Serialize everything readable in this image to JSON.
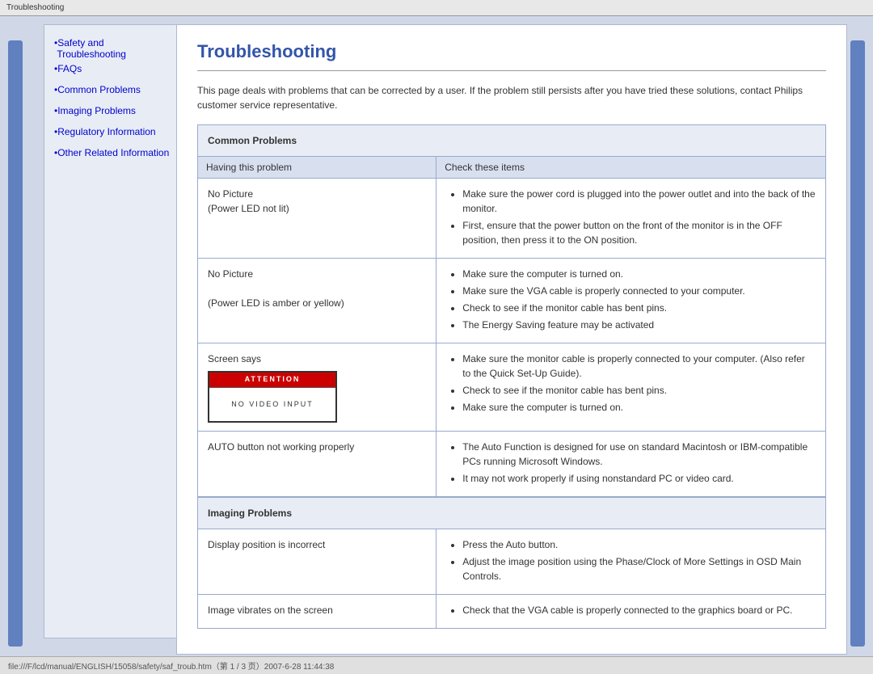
{
  "browser": {
    "title": "Troubleshooting",
    "status_bar": "file:///F/lcd/manual/ENGLISH/15058/safety/saf_troub.htm（第 1 / 3 页）2007-6-28 11:44:38"
  },
  "sidebar": {
    "links": [
      {
        "label": "Safety and Troubleshooting",
        "href": "#"
      },
      {
        "label": "FAQs",
        "href": "#"
      },
      {
        "label": "Common Problems",
        "href": "#"
      },
      {
        "label": "Imaging Problems",
        "href": "#"
      },
      {
        "label": "Regulatory Information",
        "href": "#"
      },
      {
        "label": "Other Related Information",
        "href": "#"
      }
    ]
  },
  "content": {
    "title": "Troubleshooting",
    "intro": "This page deals with problems that can be corrected by a user. If the problem still persists after you have tried these solutions, contact Philips customer service representative.",
    "common_problems_header": "Common Problems",
    "col_problem": "Having this problem",
    "col_solution": "Check these items",
    "problems": [
      {
        "problem": "No Picture\n(Power LED not lit)",
        "solutions": [
          "Make sure the power cord is plugged into the power outlet and into the back of the monitor.",
          "First, ensure that the power button on the front of the monitor is in the OFF position, then press it to the ON position."
        ]
      },
      {
        "problem": "No Picture\n\n(Power LED is amber or yellow)",
        "solutions": [
          "Make sure the computer is turned on.",
          "Make sure the VGA cable is properly connected to your computer.",
          "Check to see if the monitor cable has bent pins.",
          "The Energy Saving feature may be activated"
        ]
      },
      {
        "problem": "Screen says",
        "attention_label": "ATTENTION",
        "attention_body": "NO VIDEO INPUT",
        "solutions": [
          "Make sure the monitor cable is properly connected to your computer. (Also refer to the Quick Set-Up Guide).",
          "Check to see if the monitor cable has bent pins.",
          "Make sure the computer is turned on."
        ]
      },
      {
        "problem": "AUTO button not working properly",
        "solutions": [
          "The Auto Function is designed for use on standard Macintosh or IBM-compatible PCs running Microsoft Windows.",
          "It may not work properly if using nonstandard PC or video card."
        ]
      }
    ],
    "imaging_problems_header": "Imaging Problems",
    "imaging_problems": [
      {
        "problem": "Display position is incorrect",
        "solutions": [
          "Press the Auto button.",
          "Adjust the image position using the Phase/Clock of More Settings in OSD Main Controls."
        ]
      },
      {
        "problem": "Image vibrates on the screen",
        "solutions": [
          "Check that the VGA cable is properly connected to the graphics board or PC."
        ]
      }
    ]
  }
}
